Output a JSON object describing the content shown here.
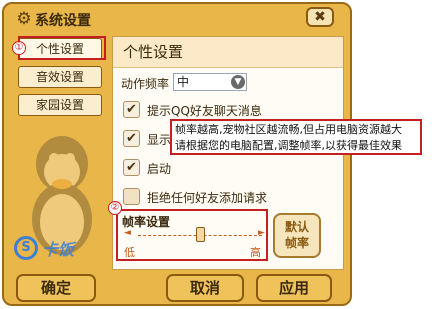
{
  "window": {
    "title": "系统设置",
    "close_label": "✖"
  },
  "sidebar": {
    "items": [
      {
        "label": "个性设置",
        "active": true
      },
      {
        "label": "音效设置",
        "active": false
      },
      {
        "label": "家园设置",
        "active": false
      }
    ]
  },
  "panel": {
    "title": "个性设置",
    "action_rate_label": "动作频率",
    "action_rate_value": "中",
    "checkboxes": [
      {
        "label": "提示QQ好友聊天消息",
        "checked": true
      },
      {
        "label": "显示",
        "checked": true
      },
      {
        "label": "启动",
        "checked": true
      },
      {
        "label": "拒绝任何好友添加请求",
        "checked": false
      }
    ]
  },
  "tooltip": {
    "line1": "帧率越高,宠物社区越流畅,但占用电脑资源越大",
    "line2": "请根据您的电脑配置,调整帧率,以获得最佳效果"
  },
  "fps": {
    "title": "帧率设置",
    "low_label": "低",
    "high_label": "高",
    "level": 0.5,
    "default_button_line1": "默认",
    "default_button_line2": "帧率"
  },
  "annotations": {
    "marker1": "①",
    "marker2": "②"
  },
  "buttons": {
    "ok": "确定",
    "cancel": "取消",
    "apply": "应用"
  },
  "watermark": {
    "logo": "S",
    "text": "卡饭"
  },
  "colors": {
    "frame": "#e9b64a",
    "border": "#9a6a18",
    "highlight": "#c52020"
  }
}
